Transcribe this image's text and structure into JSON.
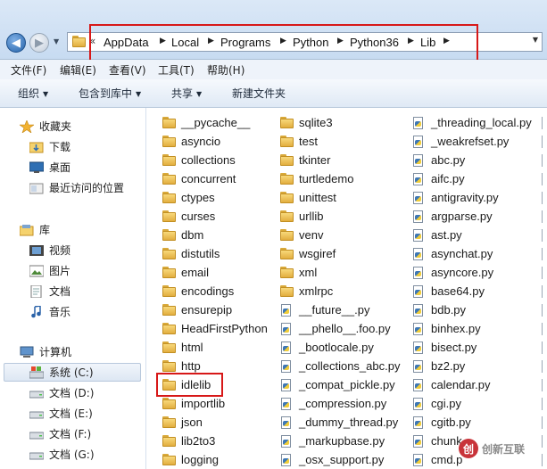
{
  "address": {
    "crumbs": [
      "AppData",
      "Local",
      "Programs",
      "Python",
      "Python36",
      "Lib"
    ],
    "history_icon": "chevron-down-icon"
  },
  "menu": [
    "文件(F)",
    "编辑(E)",
    "查看(V)",
    "工具(T)",
    "帮助(H)"
  ],
  "commands": [
    {
      "label": "组织",
      "dropdown": true
    },
    {
      "label": "包含到库中",
      "dropdown": true
    },
    {
      "label": "共享",
      "dropdown": true
    },
    {
      "label": "新建文件夹",
      "dropdown": false
    }
  ],
  "nav": {
    "favorites_label": "收藏夹",
    "favorites": [
      "下载",
      "桌面",
      "最近访问的位置"
    ],
    "libraries_label": "库",
    "libraries": [
      "视频",
      "图片",
      "文档",
      "音乐"
    ],
    "computer_label": "计算机",
    "drives": [
      "系统 (C:)",
      "文档 (D:)",
      "文档 (E:)",
      "文档 (F:)",
      "文档 (G:)"
    ],
    "selected_drive": "系统 (C:)"
  },
  "files": {
    "col1": [
      "__pycache__",
      "asyncio",
      "collections",
      "concurrent",
      "ctypes",
      "curses",
      "dbm",
      "distutils",
      "email",
      "encodings",
      "ensurepip",
      "HeadFirstPython",
      "html",
      "http",
      "idlelib",
      "importlib",
      "json",
      "lib2to3",
      "logging"
    ],
    "col2": [
      "sqlite3",
      "test",
      "tkinter",
      "turtledemo",
      "unittest",
      "urllib",
      "venv",
      "wsgiref",
      "xml",
      "xmlrpc",
      "__future__.py",
      "__phello__.foo.py",
      "_bootlocale.py",
      "_collections_abc.py",
      "_compat_pickle.py",
      "_compression.py",
      "_dummy_thread.py",
      "_markupbase.py",
      "_osx_support.py"
    ],
    "col2_folder_count": 10,
    "col3": [
      "_threading_local.py",
      "_weakrefset.py",
      "abc.py",
      "aifc.py",
      "antigravity.py",
      "argparse.py",
      "ast.py",
      "asynchat.py",
      "asyncore.py",
      "base64.py",
      "bdb.py",
      "binhex.py",
      "bisect.py",
      "bz2.py",
      "calendar.py",
      "cgi.py",
      "cgitb.py",
      "chunk",
      "cmd.p"
    ],
    "highlighted": "idlelib"
  },
  "watermark": {
    "text": "创新互联",
    "logo": "创"
  },
  "colors": {
    "highlight_box": "#d71818",
    "folder": "#e2ae3f"
  }
}
